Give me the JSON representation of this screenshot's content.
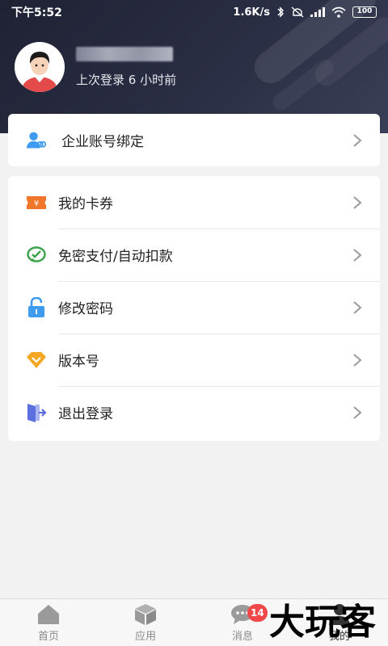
{
  "status_bar": {
    "time": "下午5:52",
    "speed": "1.6K/s",
    "battery": "100"
  },
  "profile": {
    "last_login": "上次登录 6 小时前"
  },
  "menu_top": [
    {
      "label": "企业账号绑定",
      "icon": "enterprise-user-link-icon"
    }
  ],
  "menu_main": [
    {
      "label": "我的卡券",
      "icon": "coupon-icon"
    },
    {
      "label": "免密支付/自动扣款",
      "icon": "wechat-pay-icon"
    },
    {
      "label": "修改密码",
      "icon": "lock-icon"
    },
    {
      "label": "版本号",
      "icon": "version-diamond-icon"
    },
    {
      "label": "退出登录",
      "icon": "logout-door-icon"
    }
  ],
  "tabbar": {
    "items": [
      {
        "label": "首页",
        "icon": "home-icon"
      },
      {
        "label": "应用",
        "icon": "cube-icon"
      },
      {
        "label": "消息",
        "icon": "message-icon",
        "badge": "14"
      },
      {
        "label": "我的",
        "icon": "person-icon",
        "active": true
      }
    ]
  },
  "watermark": "大玩客",
  "colors": {
    "header_bg": "#252839",
    "badge": "#f04848",
    "coupon": "#f0772a",
    "wechat": "#3aa34a",
    "lock": "#3f9bf0",
    "version": "#f5a623",
    "logout": "#5b6fe0"
  }
}
